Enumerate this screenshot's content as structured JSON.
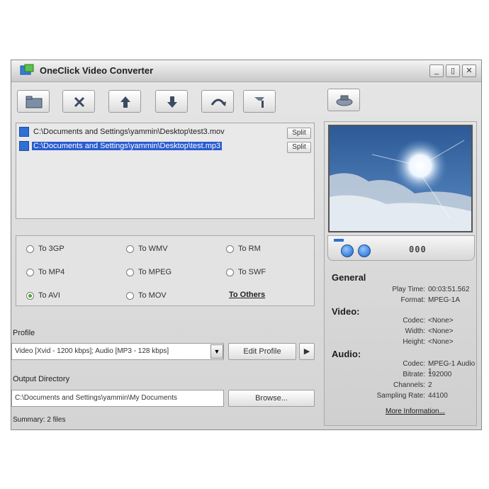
{
  "window": {
    "title": "OneClick Video Converter",
    "controls": {
      "minimize": "_",
      "maximize": "▯",
      "close": "✕"
    }
  },
  "toolbar": {
    "buttons": [
      {
        "name": "open-folder-button",
        "icon": "folder-icon"
      },
      {
        "name": "remove-button",
        "icon": "close-icon"
      },
      {
        "name": "move-up-button",
        "icon": "arrow-up-icon"
      },
      {
        "name": "move-down-button",
        "icon": "arrow-down-icon"
      },
      {
        "name": "undo-button",
        "icon": "curved-arrow-icon"
      },
      {
        "name": "settings-button",
        "icon": "wrench-icon"
      },
      {
        "name": "preview-tool-button",
        "icon": "camera-icon"
      }
    ]
  },
  "files": [
    {
      "path": "C:\\Documents and Settings\\yammin\\Desktop\\test3.mov",
      "selected": false,
      "split_label": "Split"
    },
    {
      "path": "C:\\Documents and Settings\\yammin\\Desktop\\test.mp3",
      "selected": true,
      "split_label": "Split"
    }
  ],
  "formats": {
    "options": [
      {
        "label": "To 3GP",
        "checked": false
      },
      {
        "label": "To WMV",
        "checked": false
      },
      {
        "label": "To RM",
        "checked": false
      },
      {
        "label": "To MP4",
        "checked": false
      },
      {
        "label": "To MPEG",
        "checked": false
      },
      {
        "label": "To SWF",
        "checked": false
      },
      {
        "label": "To AVI",
        "checked": true
      },
      {
        "label": "To MOV",
        "checked": false
      }
    ],
    "others_label": "To Others"
  },
  "profile": {
    "label": "Profile",
    "value": "Video [Xvid - 1200 kbps]; Audio [MP3 - 128 kbps]",
    "edit_label": "Edit Profile",
    "more_label": "▶"
  },
  "output": {
    "label": "Output Directory",
    "value": "C:\\Documents and Settings\\yammin\\My Documents",
    "browse_label": "Browse..."
  },
  "summary": "Summary: 2 files",
  "info": {
    "general_head": "General",
    "general": [
      {
        "k": "Play Time:",
        "v": "00:03:51.562"
      },
      {
        "k": "Format:",
        "v": "MPEG-1A"
      }
    ],
    "video_head": "Video:",
    "video": [
      {
        "k": "Codec:",
        "v": "<None>"
      },
      {
        "k": "Width:",
        "v": "<None>"
      },
      {
        "k": "Height:",
        "v": "<None>"
      }
    ],
    "audio_head": "Audio:",
    "audio": [
      {
        "k": "Codec:",
        "v": "MPEG-1 Audio 1"
      },
      {
        "k": "Bitrate:",
        "v": "192000"
      },
      {
        "k": "Channels:",
        "v": "2"
      },
      {
        "k": "Sampling Rate:",
        "v": "44100"
      }
    ],
    "more_link": "More Information..."
  },
  "player": {
    "time_display": "000"
  }
}
